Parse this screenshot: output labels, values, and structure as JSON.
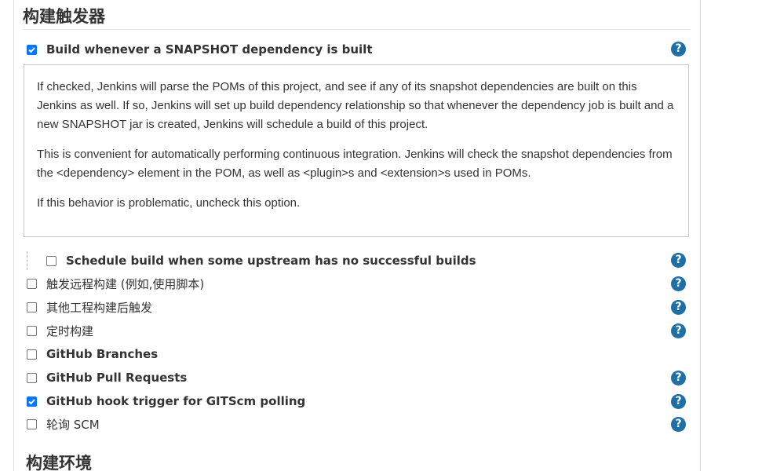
{
  "section": {
    "title": "构建触发器"
  },
  "snapshot_option": {
    "label": "Build whenever a SNAPSHOT dependency is built",
    "checked": true,
    "help_icon": "question-circle-icon"
  },
  "help_text": {
    "p1": "If checked, Jenkins will parse the POMs of this project, and see if any of its snapshot dependencies are built on this Jenkins as well. If so, Jenkins will set up build dependency relationship so that whenever the dependency job is built and a new SNAPSHOT jar is created, Jenkins will schedule a build of this project.",
    "p2": "This is convenient for automatically performing continuous integration. Jenkins will check the snapshot dependencies from the <dependency> element in the POM, as well as <plugin>s and <extension>s used in POMs.",
    "p3": "If this behavior is problematic, uncheck this option."
  },
  "sub_option": {
    "label": "Schedule build when some upstream has no successful builds",
    "checked": false
  },
  "triggers": [
    {
      "label": "触发远程构建 (例如,使用脚本)",
      "checked": false,
      "has_help": true
    },
    {
      "label": "其他工程构建后触发",
      "checked": false,
      "has_help": true
    },
    {
      "label": "定时构建",
      "checked": false,
      "has_help": true
    },
    {
      "label": "GitHub Branches",
      "checked": false,
      "has_help": false
    },
    {
      "label": "GitHub Pull Requests",
      "checked": false,
      "has_help": true
    },
    {
      "label": "GitHub hook trigger for GITScm polling",
      "checked": true,
      "has_help": true
    },
    {
      "label": "轮询 SCM",
      "checked": false,
      "has_help": true
    }
  ],
  "next_section": {
    "title": "构建环境"
  },
  "colors": {
    "accent": "#0075ff",
    "help": "#1d6fa5"
  }
}
